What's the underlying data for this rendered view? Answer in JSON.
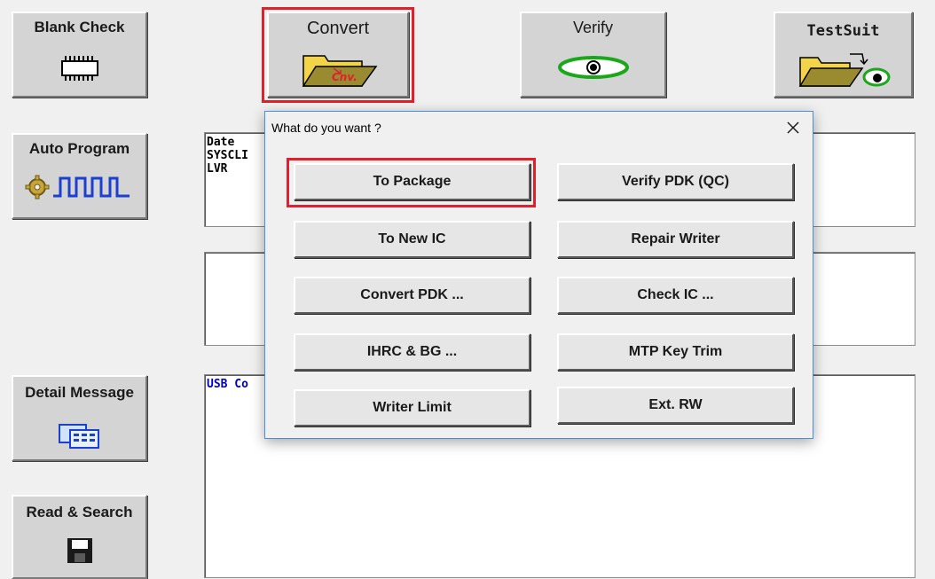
{
  "toolbar": {
    "blank_check": "Blank Check",
    "convert": "Convert",
    "verify": "Verify",
    "testsuit": "TestSuit",
    "auto_program": "Auto Program",
    "detail_message": "Detail Message",
    "read_search": "Read & Search",
    "convert_icon_text": "Cnv."
  },
  "panels": {
    "info_lines": [
      "Date",
      "SYSCLI",
      "LVR"
    ],
    "log_text": "USB Co"
  },
  "dialog": {
    "title": "What do you want ?",
    "buttons": {
      "to_package": "To Package",
      "verify_pdk_qc": "Verify PDK (QC)",
      "to_new_ic": "To New IC",
      "repair_writer": "Repair Writer",
      "convert_pdk": "Convert PDK ...",
      "check_ic": "Check IC ...",
      "ihrc_bg": "IHRC & BG ...",
      "mtp_key_trim": "MTP Key Trim",
      "writer_limit": "Writer Limit",
      "ext_rw": "Ext. RW"
    }
  },
  "colors": {
    "highlight": "#e0202c",
    "panel_text": "#000000",
    "log_text": "#0000cc"
  },
  "icons": {
    "blank_check": "chip-icon",
    "convert": "folder-convert-icon",
    "verify": "eye-icon",
    "testsuit": "folder-eye-icon",
    "auto_program": "gear-waveform-icon",
    "detail_message": "message-list-icon",
    "read_search": "floppy-disk-icon",
    "close": "close-icon"
  }
}
